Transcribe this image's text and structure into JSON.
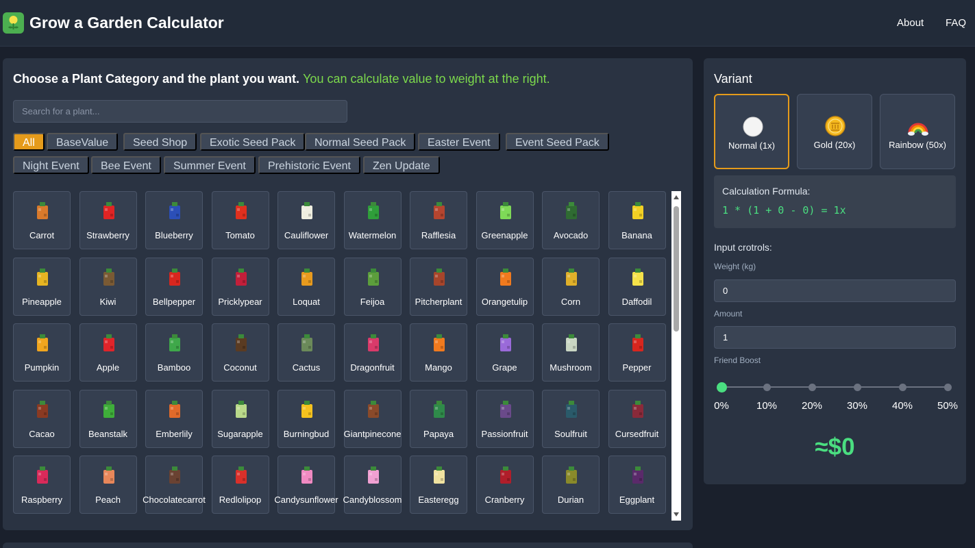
{
  "app": {
    "title": "Grow a Garden Calculator"
  },
  "nav": {
    "about": "About",
    "faq": "FAQ"
  },
  "plants_panel": {
    "heading": "Choose a Plant Category and the plant you want.",
    "heading_highlight": "You can calculate value to weight at the right.",
    "search_placeholder": "Search for a plant..."
  },
  "categories": [
    "All",
    "BaseValue",
    "Seed Shop",
    "Exotic Seed Pack",
    "Normal Seed Pack",
    "Easter Event",
    "Event Seed Pack",
    "Night Event",
    "Bee Event",
    "Summer Event",
    "Prehistoric Event",
    "Zen Update"
  ],
  "active_category": "All",
  "plants": [
    {
      "name": "Carrot",
      "icon": "carrot-icon",
      "color": "#d97a2b"
    },
    {
      "name": "Strawberry",
      "icon": "strawberry-icon",
      "color": "#e02424"
    },
    {
      "name": "Blueberry",
      "icon": "blueberry-icon",
      "color": "#2b4fb8"
    },
    {
      "name": "Tomato",
      "icon": "tomato-icon",
      "color": "#e0301e"
    },
    {
      "name": "Cauliflower",
      "icon": "cauliflower-icon",
      "color": "#efeee0"
    },
    {
      "name": "Watermelon",
      "icon": "watermelon-icon",
      "color": "#2f9e3a"
    },
    {
      "name": "Rafflesia",
      "icon": "rafflesia-icon",
      "color": "#b5452f"
    },
    {
      "name": "Greenapple",
      "icon": "greenapple-icon",
      "color": "#7ed957"
    },
    {
      "name": "Avocado",
      "icon": "avocado-icon",
      "color": "#2f6b32"
    },
    {
      "name": "Banana",
      "icon": "banana-icon",
      "color": "#f2d024"
    },
    {
      "name": "Pineapple",
      "icon": "pineapple-icon",
      "color": "#e6b422"
    },
    {
      "name": "Kiwi",
      "icon": "kiwi-icon",
      "color": "#7a5a34"
    },
    {
      "name": "Bellpepper",
      "icon": "bellpepper-icon",
      "color": "#d8261e"
    },
    {
      "name": "Pricklypear",
      "icon": "pricklypear-icon",
      "color": "#c21f3a"
    },
    {
      "name": "Loquat",
      "icon": "loquat-icon",
      "color": "#e89b1e"
    },
    {
      "name": "Feijoa",
      "icon": "feijoa-icon",
      "color": "#5c9e3c"
    },
    {
      "name": "Pitcherplant",
      "icon": "pitcherplant-icon",
      "color": "#a7452b"
    },
    {
      "name": "Orangetulip",
      "icon": "orangetulip-icon",
      "color": "#f07a1e"
    },
    {
      "name": "Corn",
      "icon": "corn-icon",
      "color": "#e0b02a"
    },
    {
      "name": "Daffodil",
      "icon": "daffodil-icon",
      "color": "#f5e24a"
    },
    {
      "name": "Pumpkin",
      "icon": "pumpkin-icon",
      "color": "#f0a51e"
    },
    {
      "name": "Apple",
      "icon": "apple-icon",
      "color": "#e0242a"
    },
    {
      "name": "Bamboo",
      "icon": "bamboo-icon",
      "color": "#3fa84a"
    },
    {
      "name": "Coconut",
      "icon": "coconut-icon",
      "color": "#5a3b22"
    },
    {
      "name": "Cactus",
      "icon": "cactus-icon",
      "color": "#6b8a5a"
    },
    {
      "name": "Dragonfruit",
      "icon": "dragonfruit-icon",
      "color": "#d93a6a"
    },
    {
      "name": "Mango",
      "icon": "mango-icon",
      "color": "#f07a1e"
    },
    {
      "name": "Grape",
      "icon": "grape-icon",
      "color": "#9a6ad9"
    },
    {
      "name": "Mushroom",
      "icon": "mushroom-icon",
      "color": "#c9d6c3"
    },
    {
      "name": "Pepper",
      "icon": "pepper-icon",
      "color": "#d8261e"
    },
    {
      "name": "Cacao",
      "icon": "cacao-icon",
      "color": "#8a3a22"
    },
    {
      "name": "Beanstalk",
      "icon": "beanstalk-icon",
      "color": "#3fae3a"
    },
    {
      "name": "Emberlily",
      "icon": "emberlily-icon",
      "color": "#e06a2a"
    },
    {
      "name": "Sugarapple",
      "icon": "sugarapple-icon",
      "color": "#b9d98a"
    },
    {
      "name": "Burningbud",
      "icon": "burningbud-icon",
      "color": "#f5c21e"
    },
    {
      "name": "Giantpinecone",
      "icon": "giantpinecone-icon",
      "color": "#8a4a2a"
    },
    {
      "name": "Papaya",
      "icon": "papaya-icon",
      "color": "#2f8a4a"
    },
    {
      "name": "Passionfruit",
      "icon": "passionfruit-icon",
      "color": "#6a4a8a"
    },
    {
      "name": "Soulfruit",
      "icon": "soulfruit-icon",
      "color": "#2a5a6a"
    },
    {
      "name": "Cursedfruit",
      "icon": "cursedfruit-icon",
      "color": "#8a2a3a"
    },
    {
      "name": "Raspberry",
      "icon": "raspberry-icon",
      "color": "#d92a5a"
    },
    {
      "name": "Peach",
      "icon": "peach-icon",
      "color": "#e8875a"
    },
    {
      "name": "Chocolatecarrot",
      "icon": "chocolatecarrot-icon",
      "color": "#6a4232"
    },
    {
      "name": "Redlolipop",
      "icon": "redlolipop-icon",
      "color": "#d9302a"
    },
    {
      "name": "Candysunflower",
      "icon": "candysunflower-icon",
      "color": "#f08ac2"
    },
    {
      "name": "Candyblossom",
      "icon": "candyblossom-icon",
      "color": "#f0a0d2"
    },
    {
      "name": "Easteregg",
      "icon": "easteregg-icon",
      "color": "#f0e2a0"
    },
    {
      "name": "Cranberry",
      "icon": "cranberry-icon",
      "color": "#b01e2a"
    },
    {
      "name": "Durian",
      "icon": "durian-icon",
      "color": "#8a8a2a"
    },
    {
      "name": "Eggplant",
      "icon": "eggplant-icon",
      "color": "#5a2a6a"
    }
  ],
  "variant": {
    "title": "Variant",
    "options": [
      {
        "label": "Normal (1x)",
        "icon": "white-circle-icon",
        "selected": true
      },
      {
        "label": "Gold (20x)",
        "icon": "gold-coin-icon",
        "selected": false
      },
      {
        "label": "Rainbow (50x)",
        "icon": "rainbow-icon",
        "selected": false
      }
    ]
  },
  "formula": {
    "label": "Calculation Formula:",
    "expression": "1 * (1 + 0 - 0) = 1x"
  },
  "inputs": {
    "title": "Input crotrols:",
    "weight_label": "Weight (kg)",
    "weight_value": "0",
    "amount_label": "Amount",
    "amount_value": "1",
    "friend_boost_label": "Friend Boost",
    "friend_boost_options": [
      "0%",
      "10%",
      "20%",
      "30%",
      "40%",
      "50%"
    ],
    "friend_boost_selected_index": 0
  },
  "result": {
    "value": "≈$0"
  },
  "colors": {
    "accent": "#e59b1b",
    "success": "#4ade80",
    "highlight": "#7cd94c"
  }
}
